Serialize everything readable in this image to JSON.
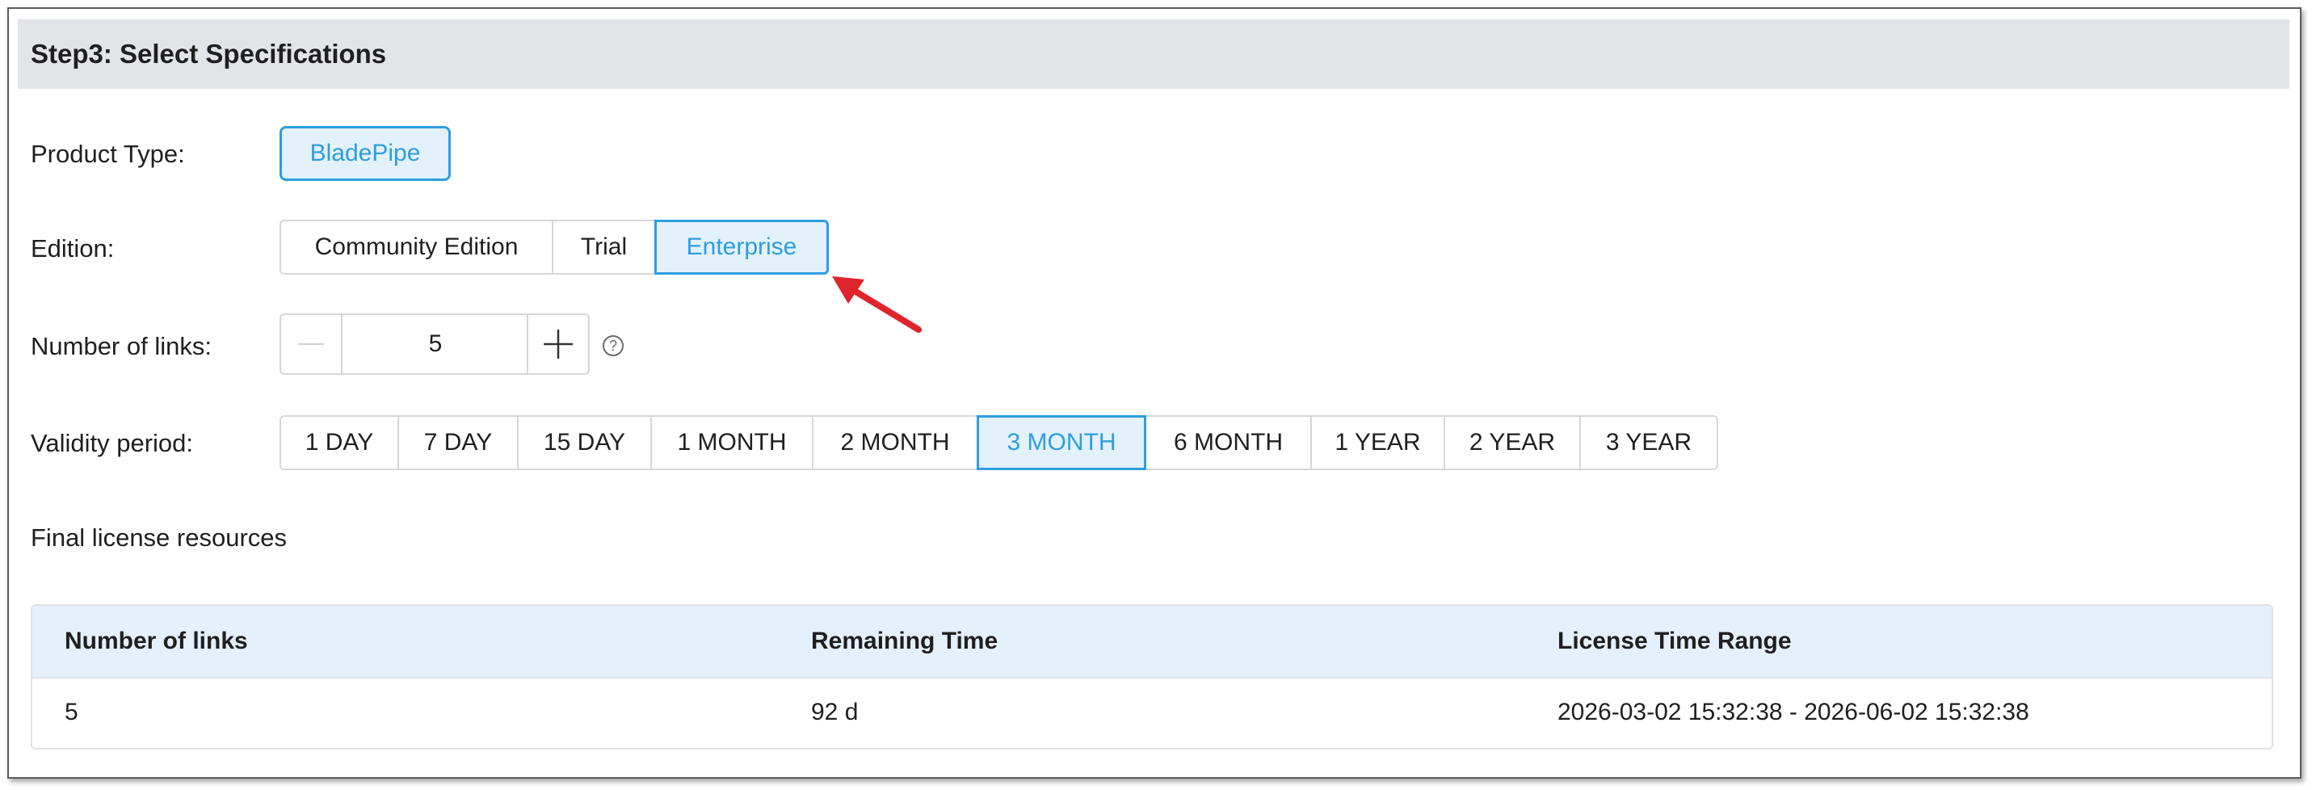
{
  "section": {
    "title": "Step3: Select Specifications"
  },
  "product_type": {
    "label": "Product Type:",
    "options": [
      "BladePipe"
    ],
    "selected": "BladePipe"
  },
  "edition": {
    "label": "Edition:",
    "options": [
      "Community Edition",
      "Trial",
      "Enterprise"
    ],
    "selected": "Enterprise"
  },
  "links": {
    "label": "Number of links:",
    "value": "5",
    "decrement_icon": "minus-icon",
    "increment_icon": "plus-icon",
    "help_icon": "question-circle-icon",
    "help_glyph": "?"
  },
  "validity": {
    "label": "Validity period:",
    "options": [
      "1 DAY",
      "7 DAY",
      "15 DAY",
      "1 MONTH",
      "2 MONTH",
      "3 MONTH",
      "6 MONTH",
      "1 YEAR",
      "2 YEAR",
      "3 YEAR"
    ],
    "selected": "3 MONTH"
  },
  "result": {
    "title": "Final license resources",
    "columns": [
      "Number of links",
      "Remaining Time",
      "License Time Range"
    ],
    "rows": [
      [
        "5",
        "92 d",
        "2026-03-02 15:32:38 - 2026-06-02 15:32:38"
      ]
    ]
  },
  "colors": {
    "accent": "#2d9ee0",
    "active_bg": "#e3f1fb",
    "header_bg": "#e3e4e8",
    "table_header_bg": "#e4f0fb",
    "annotation_arrow": "#e0242b"
  }
}
